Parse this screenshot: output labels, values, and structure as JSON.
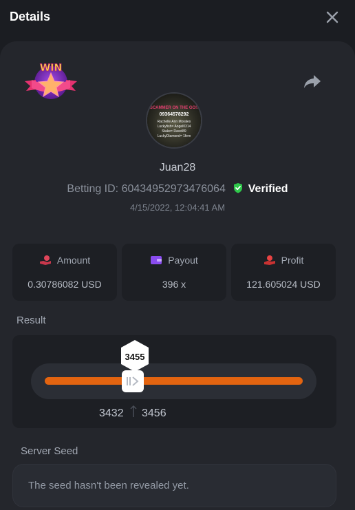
{
  "header": {
    "title": "Details"
  },
  "profile": {
    "username": "Juan28",
    "betting_id_label": "Betting ID:",
    "betting_id": "60434952973476064",
    "verified_label": "Verified",
    "timestamp": "4/15/2022, 12:04:41 AM",
    "avatar_text": {
      "line1": "SCAMMER ON THE GO!!",
      "line2": "09364578292",
      "line3": "Rachelle Ann Morales",
      "line4": "Luckyfish= Angel0314",
      "line5": "Stake= Ravel89",
      "line6": "LuckyDiamond= 1fem"
    },
    "badge_text": "WIN"
  },
  "stats": {
    "amount": {
      "label": "Amount",
      "value": "0.30786082 USD"
    },
    "payout": {
      "label": "Payout",
      "value": "396 x"
    },
    "profit": {
      "label": "Profit",
      "value": "121.605024 USD"
    }
  },
  "result": {
    "label": "Result",
    "value": "3455",
    "range_low": "3432",
    "range_high": "3456",
    "handle_position": 0.32
  },
  "server_seed": {
    "label": "Server Seed",
    "text": "The seed hasn't been revealed yet."
  },
  "colors": {
    "background": "#1b1d22",
    "panel": "#24262c",
    "accent_orange": "#e36410",
    "verified_green": "#2fc84b",
    "amount_icon": "#e0455a",
    "payout_icon": "#8a4cf0",
    "profit_icon": "#e84343"
  },
  "icons": {
    "close": "close-icon",
    "share": "share-icon",
    "verified": "shield-check-icon",
    "amount": "coin-hand-icon",
    "payout": "wallet-icon",
    "profit": "money-hand-icon",
    "handle": "slider-handle-icon"
  }
}
